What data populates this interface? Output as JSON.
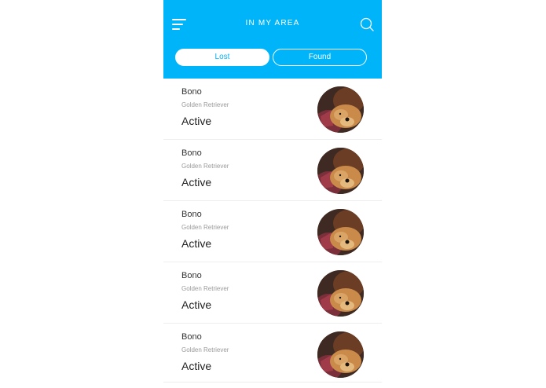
{
  "header": {
    "title": "IN MY AREA",
    "menu_icon": "menu-icon",
    "search_icon": "search-icon",
    "background": "#00b4fa"
  },
  "segments": {
    "lost_label": "Lost",
    "found_label": "Found",
    "selected": "Lost"
  },
  "pets": [
    {
      "name": "Bono",
      "breed": "Golden Retriever",
      "status": "Active",
      "avatar": "dog-photo"
    },
    {
      "name": "Bono",
      "breed": "Golden Retriever",
      "status": "Active",
      "avatar": "dog-photo"
    },
    {
      "name": "Bono",
      "breed": "Golden Retriever",
      "status": "Active",
      "avatar": "dog-photo"
    },
    {
      "name": "Bono",
      "breed": "Golden Retriever",
      "status": "Active",
      "avatar": "dog-photo"
    },
    {
      "name": "Bono",
      "breed": "Golden Retriever",
      "status": "Active",
      "avatar": "dog-photo"
    }
  ]
}
